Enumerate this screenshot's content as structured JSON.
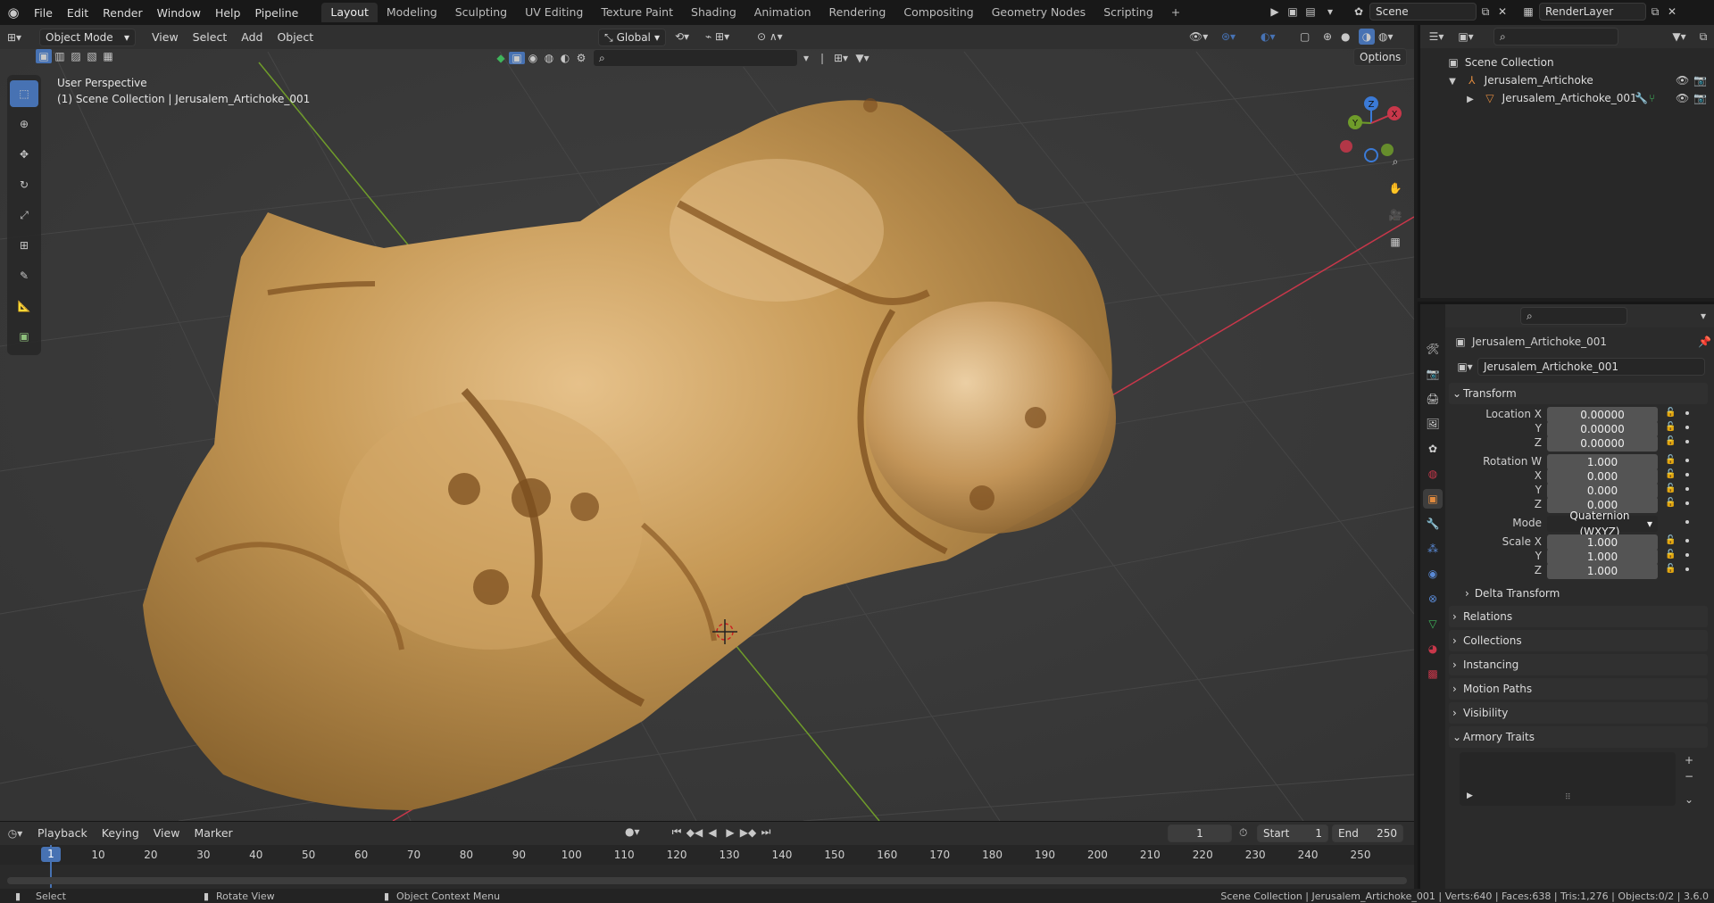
{
  "topbar": {
    "menus": [
      "File",
      "Edit",
      "Render",
      "Window",
      "Help",
      "Pipeline"
    ],
    "workspaces": [
      "Layout",
      "Modeling",
      "Sculpting",
      "UV Editing",
      "Texture Paint",
      "Shading",
      "Animation",
      "Rendering",
      "Compositing",
      "Geometry Nodes",
      "Scripting"
    ],
    "active_workspace": "Layout",
    "add_tab": "+",
    "scene": "Scene",
    "render_layer": "RenderLayer"
  },
  "viewport": {
    "mode": "Object Mode",
    "menus": [
      "View",
      "Select",
      "Add",
      "Object"
    ],
    "orientation": "Global",
    "options": "Options",
    "perspective": "User Perspective",
    "collection_info": "(1) Scene Collection | Jerusalem_Artichoke_001",
    "gizmo": {
      "x": "X",
      "y": "Y",
      "z": "Z"
    }
  },
  "outliner": {
    "root": "Scene Collection",
    "items": [
      {
        "name": "Jerusalem_Artichoke",
        "depth": 1
      },
      {
        "name": "Jerusalem_Artichoke_001",
        "depth": 2
      }
    ]
  },
  "properties": {
    "object_name": "Jerusalem_Artichoke_001",
    "datablock": "Jerusalem_Artichoke_001",
    "transform": {
      "title": "Transform",
      "location_label": "Location X",
      "location": [
        "0.00000",
        "0.00000",
        "0.00000"
      ],
      "rotation_label": "Rotation W",
      "rotation": [
        "1.000",
        "0.000",
        "0.000",
        "0.000"
      ],
      "mode_label": "Mode",
      "mode": "Quaternion (WXYZ)",
      "scale_label": "Scale X",
      "scale": [
        "1.000",
        "1.000",
        "1.000"
      ],
      "axis_y": "Y",
      "axis_z": "Z",
      "axis_x": "X"
    },
    "subpanels": [
      "Delta Transform"
    ],
    "panels": [
      "Relations",
      "Collections",
      "Instancing",
      "Motion Paths",
      "Visibility",
      "Armory Traits"
    ]
  },
  "timeline": {
    "menus": [
      "Playback",
      "Keying",
      "View",
      "Marker"
    ],
    "current_frame": "1",
    "start_label": "Start",
    "start": "1",
    "end_label": "End",
    "end": "250",
    "ticks": [
      "1",
      "10",
      "20",
      "30",
      "40",
      "50",
      "60",
      "70",
      "80",
      "90",
      "100",
      "110",
      "120",
      "130",
      "140",
      "150",
      "160",
      "170",
      "180",
      "190",
      "200",
      "210",
      "220",
      "230",
      "240",
      "250"
    ]
  },
  "status": {
    "select": "Select",
    "rotate": "Rotate View",
    "context": "Object Context Menu",
    "stats": "Scene Collection | Jerusalem_Artichoke_001 | Verts:640 | Faces:638 | Tris:1,276 | Objects:0/2 | 3.6.0"
  },
  "colors": {
    "accent": "#4772b3",
    "x_axis": "#c8374a",
    "y_axis": "#6f9c2a",
    "z_axis": "#3b7ad6",
    "artichoke": "#c89c5a"
  }
}
